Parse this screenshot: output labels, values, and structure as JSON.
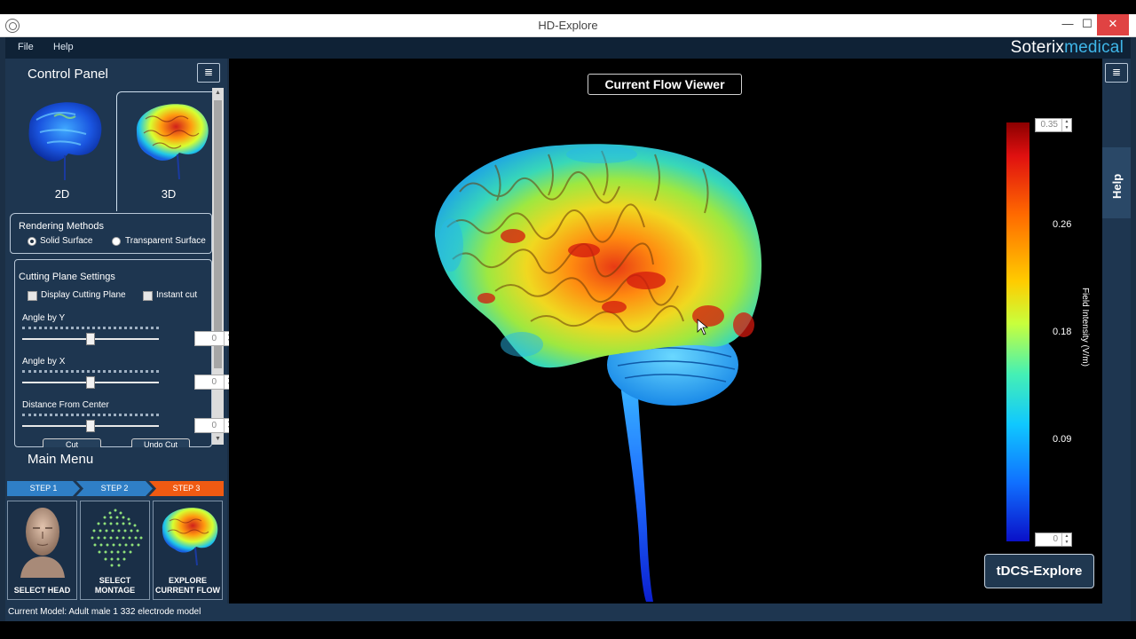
{
  "window": {
    "title": "HD-Explore",
    "minimize": "—",
    "maximize": "☐",
    "close": "✕"
  },
  "menubar": {
    "file": "File",
    "help": "Help"
  },
  "brand": {
    "part1": "Soterix",
    "part2": "medical"
  },
  "control_panel": {
    "title": "Control Panel",
    "menu_icon": "≣",
    "tabs": [
      {
        "label": "2D"
      },
      {
        "label": "3D"
      }
    ],
    "rendering": {
      "title": "Rendering Methods",
      "options": [
        {
          "label": "Solid Surface",
          "selected": true
        },
        {
          "label": "Transparent Surface",
          "selected": false
        }
      ]
    },
    "cutting": {
      "title": "Cutting Plane Settings",
      "display_cutting_plane": "Display Cutting Plane",
      "instant_cut": "Instant cut",
      "angle_y": {
        "label": "Angle by Y",
        "value": "0",
        "slider_value": 0.5
      },
      "angle_x": {
        "label": "Angle by X",
        "value": "0",
        "slider_value": 0.5
      },
      "distance": {
        "label": "Distance From Center",
        "value": "0",
        "slider_value": 0.5
      },
      "cut_button": "Cut",
      "undo_button": "Undo Cut"
    }
  },
  "main_menu": {
    "title": "Main Menu",
    "steps": [
      {
        "label": "STEP 1"
      },
      {
        "label": "STEP 2"
      },
      {
        "label": "STEP 3"
      }
    ],
    "tiles": [
      {
        "line1": "SELECT HEAD",
        "line2": ""
      },
      {
        "line1": "SELECT",
        "line2": "MONTAGE"
      },
      {
        "line1": "EXPLORE",
        "line2": "CURRENT FLOW"
      }
    ]
  },
  "status": {
    "text": "Current Model: Adult male 1 332 electrode model"
  },
  "viewer": {
    "title": "Current Flow Viewer",
    "colorbar": {
      "max_value": "0.35",
      "min_value": "0",
      "ticks": [
        "0.26",
        "0.18",
        "0.09"
      ],
      "axis_label": "Field Intensity (V/m)"
    },
    "tdcs_button": "tDCS-Explore"
  },
  "right_panel": {
    "menu_icon": "≣",
    "help_tab": "Help"
  },
  "colors": {
    "panel_bg": "#1e3650",
    "step_active": "#f05a12",
    "step_inactive": "#2f7fc6",
    "brand_accent": "#3fb6e8",
    "close_red": "#e04343"
  },
  "icons": [
    "app-brain-icon",
    "list-menu-icon",
    "brain-2d-thumbnail",
    "brain-3d-thumbnail",
    "head-model-image",
    "electrode-grid-image",
    "brain-current-thumbnail",
    "radio-icon",
    "checkbox-icon",
    "cursor-icon"
  ]
}
